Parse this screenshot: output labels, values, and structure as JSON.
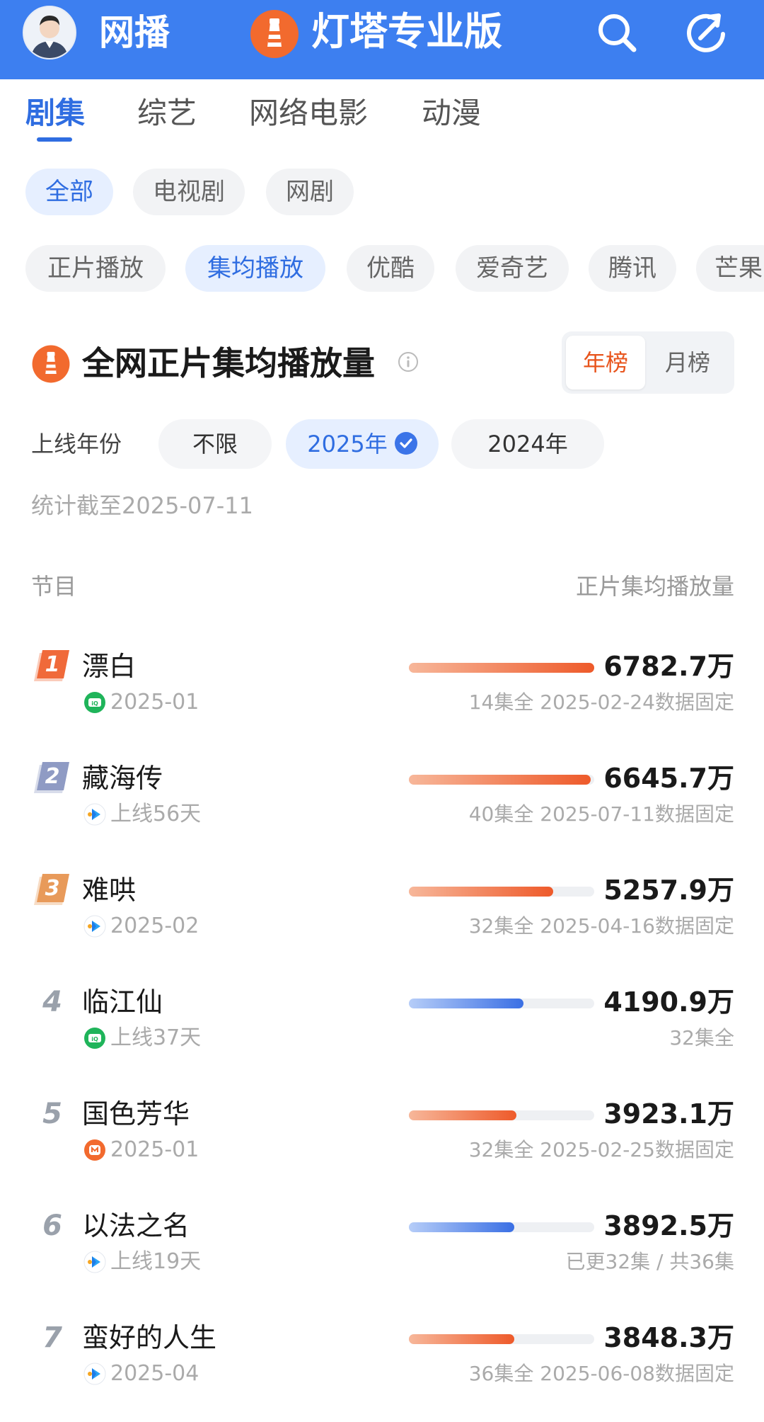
{
  "topbar": {
    "title": "网播",
    "pro_title": "灯塔专业版"
  },
  "category_tabs": [
    {
      "label": "剧集"
    },
    {
      "label": "综艺"
    },
    {
      "label": "网络电影"
    },
    {
      "label": "动漫"
    }
  ],
  "type_filters": [
    {
      "label": "全部"
    },
    {
      "label": "电视剧"
    },
    {
      "label": "网剧"
    }
  ],
  "metric_filters": [
    {
      "label": "正片播放"
    },
    {
      "label": "集均播放"
    },
    {
      "label": "优酷"
    },
    {
      "label": "爱奇艺"
    },
    {
      "label": "腾讯"
    },
    {
      "label": "芒果"
    }
  ],
  "section": {
    "title": "全网正片集均播放量",
    "toggle": [
      {
        "label": "年榜"
      },
      {
        "label": "月榜"
      }
    ]
  },
  "year_filter": {
    "label": "上线年份",
    "options": [
      {
        "label": "不限"
      },
      {
        "label": "2025年"
      },
      {
        "label": "2024年"
      }
    ]
  },
  "stat_date": "统计截至2025-07-11",
  "table": {
    "col_left": "节目",
    "col_right": "正片集均播放量",
    "rows": [
      {
        "rank": "1",
        "title": "漂白",
        "platform_icon": "iqiyi-icon",
        "sub": "2025-01",
        "value": "6782.7万",
        "note": "14集全 2025-02-24数据固定",
        "bar": 1.0,
        "bar_color": "orange",
        "rank_color": "#f06a3a"
      },
      {
        "rank": "2",
        "title": "藏海传",
        "platform_icon": "youku-icon",
        "sub": "上线56天",
        "value": "6645.7万",
        "note": "40集全 2025-07-11数据固定",
        "bar": 0.98,
        "bar_color": "orange",
        "rank_color": "#8f9bc4"
      },
      {
        "rank": "3",
        "title": "难哄",
        "platform_icon": "youku-icon",
        "sub": "2025-02",
        "value": "5257.9万",
        "note": "32集全 2025-04-16数据固定",
        "bar": 0.78,
        "bar_color": "orange",
        "rank_color": "#e89a5a"
      },
      {
        "rank": "4",
        "title": "临江仙",
        "platform_icon": "iqiyi-icon",
        "sub": "上线37天",
        "value": "4190.9万",
        "note": "32集全",
        "bar": 0.62,
        "bar_color": "blue"
      },
      {
        "rank": "5",
        "title": "国色芳华",
        "platform_icon": "mango-icon",
        "sub": "2025-01",
        "value": "3923.1万",
        "note": "32集全 2025-02-25数据固定",
        "bar": 0.58,
        "bar_color": "orange"
      },
      {
        "rank": "6",
        "title": "以法之名",
        "platform_icon": "youku-icon",
        "sub": "上线19天",
        "value": "3892.5万",
        "note": "已更32集 / 共36集",
        "bar": 0.57,
        "bar_color": "blue"
      },
      {
        "rank": "7",
        "title": "蛮好的人生",
        "platform_icon": "youku-icon",
        "sub": "2025-04",
        "value": "3848.3万",
        "note": "36集全 2025-06-08数据固定",
        "bar": 0.57,
        "bar_color": "orange"
      }
    ]
  }
}
